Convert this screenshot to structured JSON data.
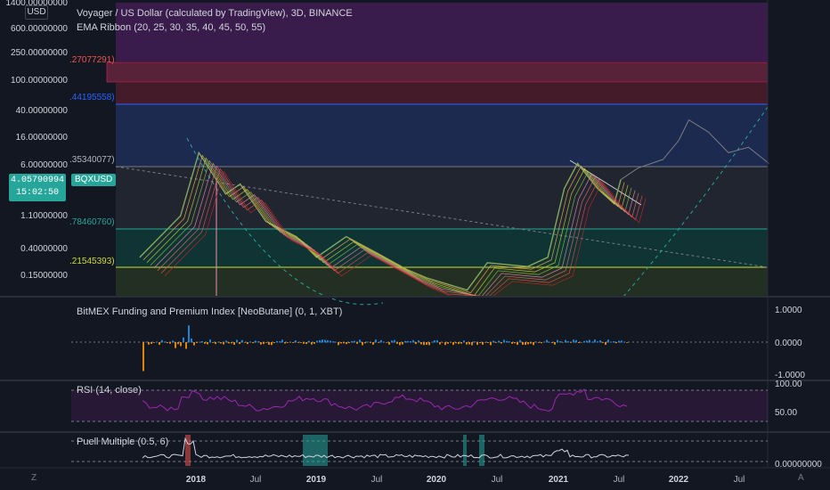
{
  "header": {
    "title": "Voyager / US Dollar (calculated by TradingView), 3D, BINANCE",
    "indicator": "EMA Ribbon (20, 25, 30, 35, 40, 45, 50, 55)",
    "currency": "USD"
  },
  "price_badge": {
    "price": "4.05790994",
    "countdown": "15:02:50",
    "symbol": "BQXUSD"
  },
  "price_axis_labels": [
    "1400.00000000",
    "600.00000000",
    "250.00000000",
    "100.00000000",
    "40.00000000",
    "16.00000000",
    "6.00000000",
    "1.10000000",
    "0.40000000",
    "0.15000000"
  ],
  "fib_labels": [
    ".27077291)",
    ".44195558)",
    ".35340077)",
    ".78460760)",
    ".21545393)"
  ],
  "time_labels": [
    "2018",
    "Jul",
    "2019",
    "Jul",
    "2020",
    "Jul",
    "2021",
    "Jul",
    "2022",
    "Jul"
  ],
  "panes": {
    "funding": {
      "title": "BitMEX Funding and Premium Index [NeoButane] (0, 1, XBT)",
      "scale": [
        "1.0000",
        "0.0000",
        "-1.0000"
      ]
    },
    "rsi": {
      "title": "RSI (14, close)",
      "scale": [
        "100.00",
        "50.00"
      ]
    },
    "puell": {
      "title": "Puell Multiple (0.5, 6)",
      "scale": [
        "0.00000000"
      ]
    }
  },
  "corner": {
    "left": "Z",
    "right": "A"
  },
  "colors": {
    "background": "#131722",
    "up": "#26a69a",
    "rsi": "#9c27b0",
    "zone_purple": "#4a1f5c",
    "zone_red": "#5a1f2c",
    "zone_blue": "#1e2f5a"
  },
  "chart_data": {
    "type": "candlestick",
    "scale": "log",
    "title": "Voyager / US Dollar (calculated by TradingView), 3D, BINANCE",
    "ylim": [
      0.1,
      1400
    ],
    "price_series": [
      [
        "2017-07-15",
        0.3
      ],
      [
        "2017-11-15",
        1.2
      ],
      [
        "2018-01-10",
        10
      ],
      [
        "2018-04-01",
        2.5
      ],
      [
        "2018-05-15",
        3.5
      ],
      [
        "2018-08-01",
        1.0
      ],
      [
        "2018-11-01",
        0.6
      ],
      [
        "2019-01-01",
        0.3
      ],
      [
        "2019-04-01",
        0.6
      ],
      [
        "2019-07-01",
        0.35
      ],
      [
        "2019-10-01",
        0.2
      ],
      [
        "2019-12-01",
        0.15
      ],
      [
        "2020-04-01",
        0.1
      ],
      [
        "2020-06-01",
        0.25
      ],
      [
        "2020-10-01",
        0.22
      ],
      [
        "2020-12-01",
        0.3
      ],
      [
        "2021-01-20",
        3.0
      ],
      [
        "2021-03-01",
        7.0
      ],
      [
        "2021-05-01",
        3.0
      ],
      [
        "2021-06-20",
        1.8
      ],
      [
        "2021-07-10",
        4.06
      ]
    ],
    "projection": [
      [
        "2021-07-10",
        4.06
      ],
      [
        "2021-09-01",
        6
      ],
      [
        "2021-11-15",
        8
      ],
      [
        "2022-01-01",
        15
      ],
      [
        "2022-02-01",
        30
      ],
      [
        "2022-04-01",
        20
      ],
      [
        "2022-06-01",
        10
      ],
      [
        "2022-08-01",
        12
      ],
      [
        "2022-10-01",
        7
      ]
    ],
    "rsi_range": [
      0,
      100
    ],
    "funding_range": [
      -1,
      1
    ]
  }
}
